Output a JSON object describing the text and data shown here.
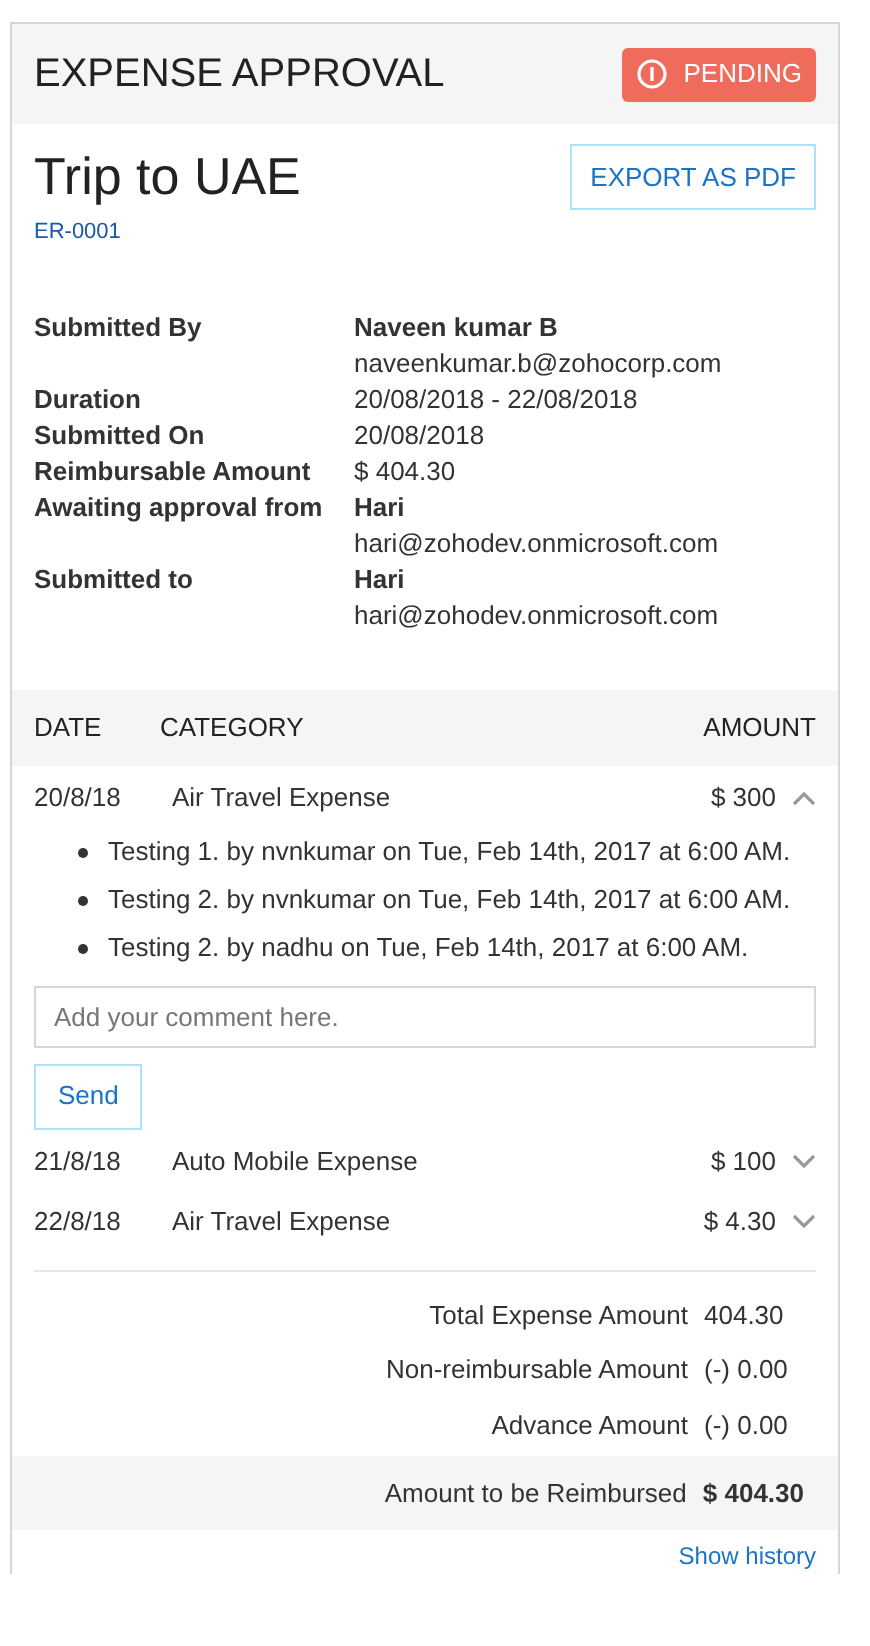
{
  "header": {
    "title": "EXPENSE APPROVAL",
    "status": "PENDING"
  },
  "report": {
    "title": "Trip to UAE",
    "id": "ER-0001",
    "export_button": "EXPORT AS PDF"
  },
  "details": [
    {
      "label": "Submitted By",
      "values": [
        "Naveen kumar B",
        "naveenkumar.b@zohocorp.com"
      ]
    },
    {
      "label": "Duration",
      "values": [
        "20/08/2018 - 22/08/2018"
      ]
    },
    {
      "label": "Submitted On",
      "values": [
        "20/08/2018"
      ]
    },
    {
      "label": "Reimbursable Amount",
      "values": [
        "$ 404.30"
      ]
    },
    {
      "label": "Awaiting approval from",
      "values": [
        "Hari",
        "hari@zohodev.onmicrosoft.com"
      ]
    },
    {
      "label": "Submitted to",
      "values": [
        "Hari",
        "hari@zohodev.onmicrosoft.com"
      ]
    }
  ],
  "table": {
    "columns": [
      "DATE",
      "CATEGORY",
      "AMOUNT"
    ],
    "rows": [
      {
        "date": "20/8/18",
        "category": "Air Travel Expense",
        "amount": "$ 300",
        "expanded": true,
        "comments": [
          "Testing 1. by nvnkumar on Tue, Feb 14th, 2017 at 6:00 AM.",
          "Testing 2. by nvnkumar on Tue, Feb 14th, 2017 at 6:00 AM.",
          "Testing 2. by nadhu on Tue, Feb 14th, 2017 at 6:00 AM."
        ],
        "comment_field": {
          "placeholder": "Add your comment here."
        },
        "send_button": "Send"
      },
      {
        "date": "21/8/18",
        "category": "Auto Mobile Expense",
        "amount": "$ 100",
        "expanded": false
      },
      {
        "date": "22/8/18",
        "category": "Air Travel Expense",
        "amount": "$ 4.30",
        "expanded": false
      }
    ]
  },
  "summary": [
    {
      "label": "Total Expense Amount",
      "value": "404.30"
    },
    {
      "label": "Non-reimbursable Amount",
      "value": "(-) 0.00"
    },
    {
      "label": "Advance Amount",
      "value": "(-) 0.00"
    }
  ],
  "reimbursed": {
    "label": "Amount to be Reimbursed",
    "value": "$ 404.30"
  },
  "history_link": "Show history"
}
